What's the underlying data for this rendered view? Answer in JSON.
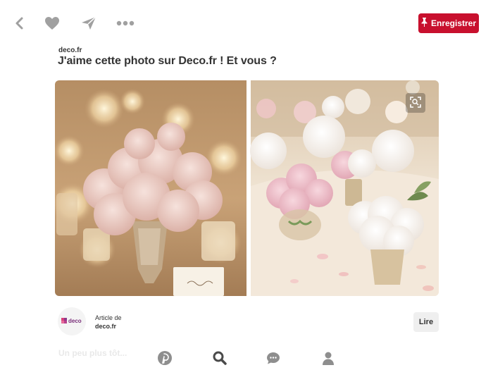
{
  "toolbar": {
    "save_label": "Enregistrer",
    "icons": [
      "chevron-left-icon",
      "heart-icon",
      "send-icon",
      "more-icon"
    ]
  },
  "pin": {
    "source_domain": "deco.fr",
    "title": "J'aime cette photo sur Deco.fr ! Et vous ?"
  },
  "article": {
    "prefix": "Article de",
    "site": "deco.fr",
    "read_label": "Lire",
    "logo_text": "deco"
  },
  "footer": {
    "ghost_text": "Un peu plus tôt..."
  },
  "bottom_nav": {
    "items": [
      "home-icon",
      "search-icon",
      "chat-icon",
      "profile-icon"
    ]
  },
  "colors": {
    "accent": "#c8102e",
    "icon_gray": "#9b9b9b",
    "nav_gray": "#6e6e6e"
  }
}
